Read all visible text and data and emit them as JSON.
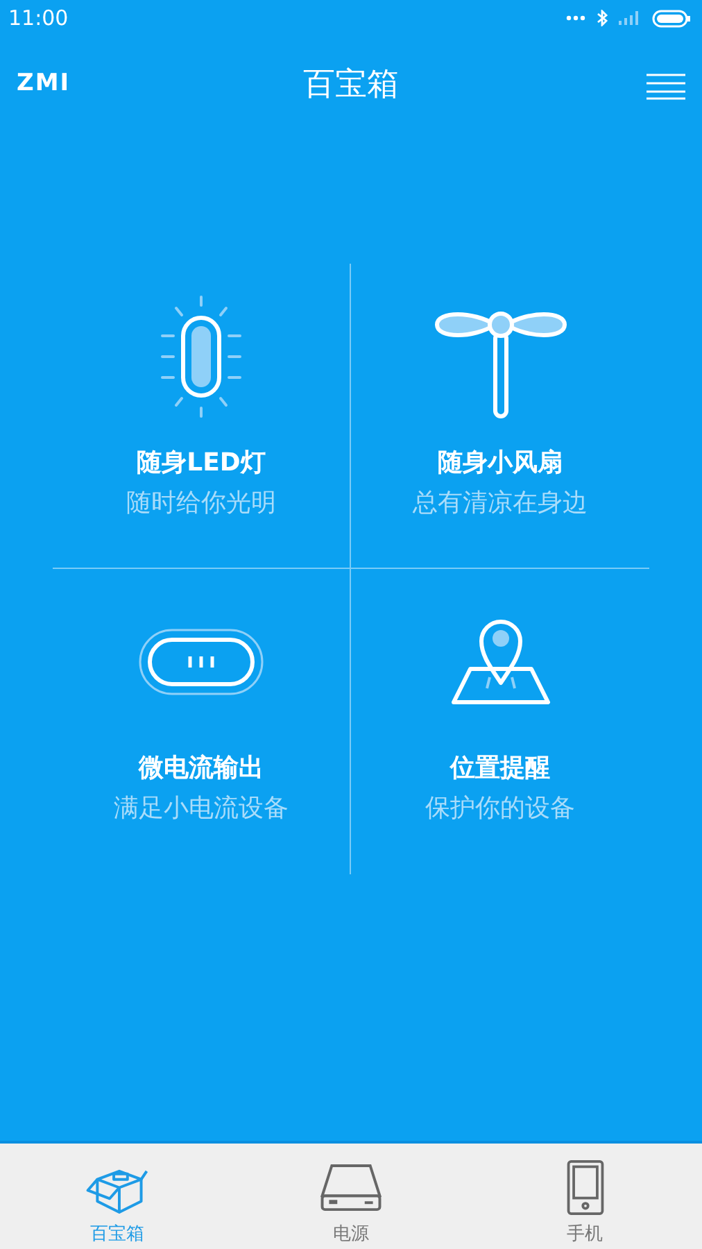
{
  "status_bar": {
    "time": "11:00"
  },
  "header": {
    "logo": "ZMI",
    "title": "百宝箱"
  },
  "tiles": [
    {
      "kind": "led",
      "title": "随身LED灯",
      "subtitle": "随时给你光明"
    },
    {
      "kind": "fan",
      "title": "随身小风扇",
      "subtitle": "总有清凉在身边"
    },
    {
      "kind": "usb",
      "title": "微电流输出",
      "subtitle": "满足小电流设备"
    },
    {
      "kind": "location",
      "title": "位置提醒",
      "subtitle": "保护你的设备"
    }
  ],
  "tabs": [
    {
      "kind": "box",
      "label": "百宝箱",
      "selected": true
    },
    {
      "kind": "powerbank",
      "label": "电源",
      "selected": false
    },
    {
      "kind": "phone",
      "label": "手机",
      "selected": false
    }
  ]
}
